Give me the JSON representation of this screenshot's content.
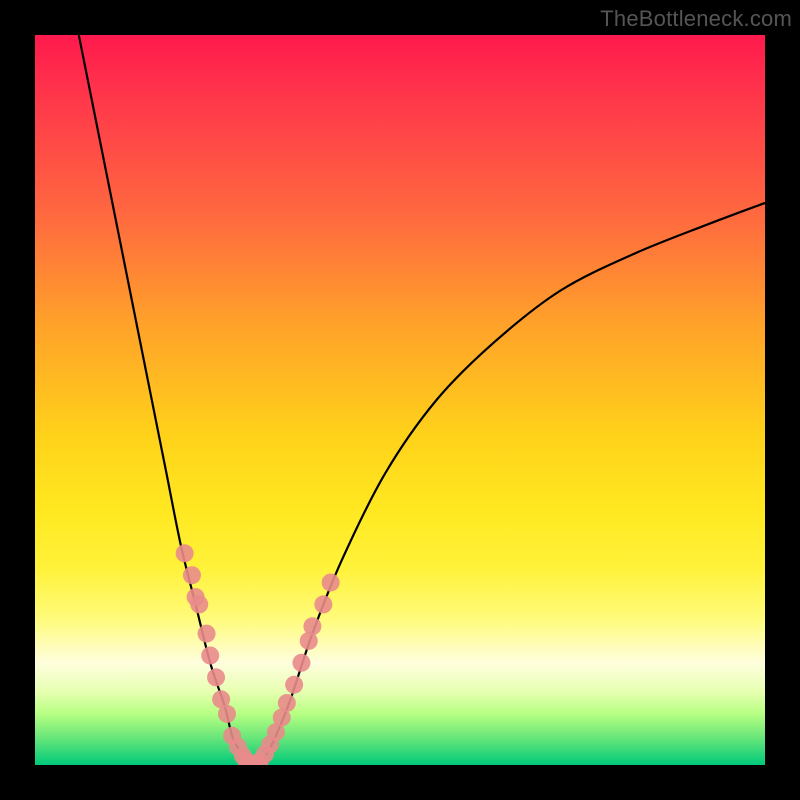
{
  "watermark": "TheBottleneck.com",
  "chart_data": {
    "type": "line",
    "title": "",
    "xlabel": "",
    "ylabel": "",
    "x_range": [
      0,
      100
    ],
    "y_range": [
      0,
      100
    ],
    "curve": [
      {
        "x": 6,
        "y": 100
      },
      {
        "x": 8,
        "y": 90
      },
      {
        "x": 10,
        "y": 80
      },
      {
        "x": 12,
        "y": 70
      },
      {
        "x": 14,
        "y": 60
      },
      {
        "x": 16,
        "y": 50
      },
      {
        "x": 18,
        "y": 40
      },
      {
        "x": 20,
        "y": 30
      },
      {
        "x": 22,
        "y": 22
      },
      {
        "x": 24,
        "y": 14
      },
      {
        "x": 26,
        "y": 8
      },
      {
        "x": 27,
        "y": 4
      },
      {
        "x": 28,
        "y": 2
      },
      {
        "x": 29,
        "y": 0.5
      },
      {
        "x": 30,
        "y": 0
      },
      {
        "x": 31,
        "y": 0.5
      },
      {
        "x": 32,
        "y": 2
      },
      {
        "x": 33,
        "y": 4
      },
      {
        "x": 35,
        "y": 9
      },
      {
        "x": 38,
        "y": 18
      },
      {
        "x": 42,
        "y": 28
      },
      {
        "x": 48,
        "y": 40
      },
      {
        "x": 55,
        "y": 50
      },
      {
        "x": 63,
        "y": 58
      },
      {
        "x": 72,
        "y": 65
      },
      {
        "x": 82,
        "y": 70
      },
      {
        "x": 92,
        "y": 74
      },
      {
        "x": 100,
        "y": 77
      }
    ],
    "points": [
      {
        "x": 20.5,
        "y": 29
      },
      {
        "x": 21.5,
        "y": 26
      },
      {
        "x": 22.5,
        "y": 22
      },
      {
        "x": 22.0,
        "y": 23
      },
      {
        "x": 23.5,
        "y": 18
      },
      {
        "x": 24.0,
        "y": 15
      },
      {
        "x": 24.8,
        "y": 12
      },
      {
        "x": 25.5,
        "y": 9
      },
      {
        "x": 26.3,
        "y": 7
      },
      {
        "x": 27.0,
        "y": 4
      },
      {
        "x": 27.8,
        "y": 2.5
      },
      {
        "x": 28.5,
        "y": 1.2
      },
      {
        "x": 29.0,
        "y": 0.5
      },
      {
        "x": 29.5,
        "y": 0.2
      },
      {
        "x": 30.3,
        "y": 0.2
      },
      {
        "x": 30.8,
        "y": 0.5
      },
      {
        "x": 31.5,
        "y": 1.5
      },
      {
        "x": 32.2,
        "y": 2.8
      },
      {
        "x": 33.0,
        "y": 4.5
      },
      {
        "x": 33.8,
        "y": 6.5
      },
      {
        "x": 34.5,
        "y": 8.5
      },
      {
        "x": 35.5,
        "y": 11
      },
      {
        "x": 36.5,
        "y": 14
      },
      {
        "x": 37.5,
        "y": 17
      },
      {
        "x": 38.0,
        "y": 19
      },
      {
        "x": 39.5,
        "y": 22
      },
      {
        "x": 40.5,
        "y": 25
      }
    ],
    "gradient_stops": [
      {
        "pos": 0,
        "color": "#ff1a4d"
      },
      {
        "pos": 10,
        "color": "#ff3b4a"
      },
      {
        "pos": 25,
        "color": "#ff6a3f"
      },
      {
        "pos": 40,
        "color": "#ffa329"
      },
      {
        "pos": 55,
        "color": "#ffd21a"
      },
      {
        "pos": 65,
        "color": "#ffe820"
      },
      {
        "pos": 73,
        "color": "#fff23a"
      },
      {
        "pos": 80,
        "color": "#fffb7b"
      },
      {
        "pos": 86,
        "color": "#fffede"
      },
      {
        "pos": 90,
        "color": "#e6ffb0"
      },
      {
        "pos": 93,
        "color": "#b6ff82"
      },
      {
        "pos": 96,
        "color": "#6fe87a"
      },
      {
        "pos": 100,
        "color": "#00c97a"
      }
    ]
  }
}
